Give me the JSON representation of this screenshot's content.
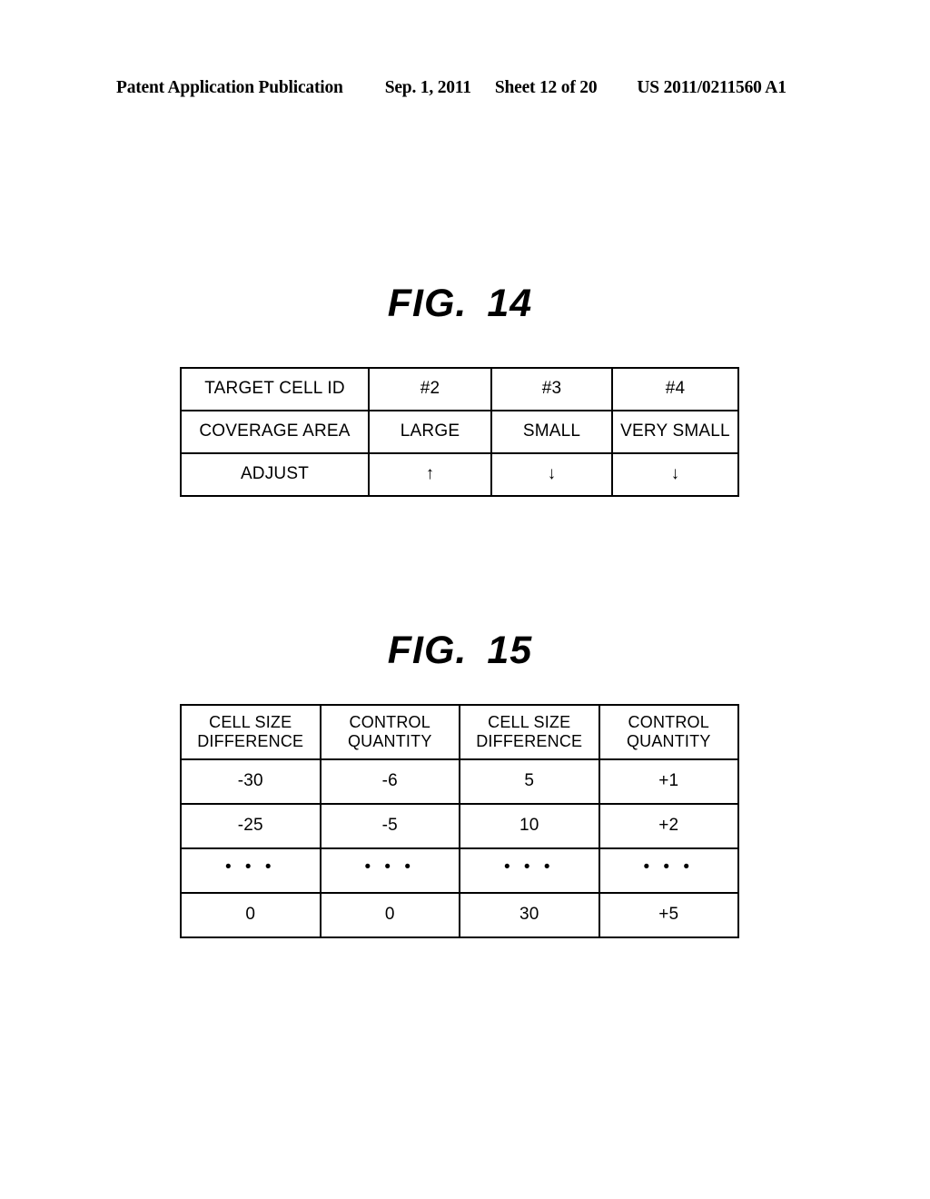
{
  "header": {
    "publication": "Patent Application Publication",
    "date": "Sep. 1, 2011",
    "sheet": "Sheet 12 of 20",
    "patent_number": "US 2011/0211560 A1"
  },
  "figures": [
    {
      "id": "fig14",
      "title_prefix": "FIG.",
      "title_number": "14",
      "table": {
        "rows": [
          {
            "label": "TARGET CELL ID",
            "cells": [
              "#2",
              "#3",
              "#4"
            ]
          },
          {
            "label": "COVERAGE AREA",
            "cells": [
              "LARGE",
              "SMALL",
              "VERY SMALL"
            ]
          },
          {
            "label": "ADJUST",
            "cells": [
              "↑",
              "↓",
              "↓"
            ]
          }
        ]
      }
    },
    {
      "id": "fig15",
      "title_prefix": "FIG.",
      "title_number": "15",
      "table": {
        "headers": [
          {
            "line1": "CELL SIZE",
            "line2": "DIFFERENCE"
          },
          {
            "line1": "CONTROL",
            "line2": "QUANTITY"
          },
          {
            "line1": "CELL SIZE",
            "line2": "DIFFERENCE"
          },
          {
            "line1": "CONTROL",
            "line2": "QUANTITY"
          }
        ],
        "rows": [
          [
            "-30",
            "-6",
            "5",
            "+1"
          ],
          [
            "-25",
            "-5",
            "10",
            "+2"
          ],
          [
            "• • •",
            "• • •",
            "• • •",
            "• • •"
          ],
          [
            "0",
            "0",
            "30",
            "+5"
          ]
        ]
      }
    }
  ],
  "colors": {
    "ink": "#000000",
    "paper": "#ffffff"
  }
}
